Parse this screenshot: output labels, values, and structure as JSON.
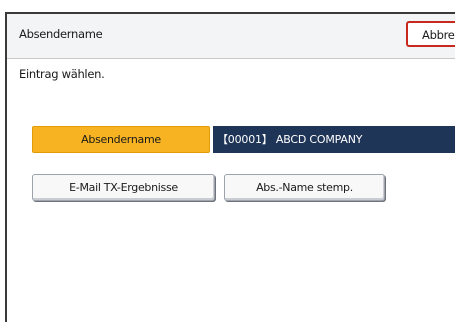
{
  "header": {
    "title": "Absendername",
    "abort_label": "Abbre"
  },
  "instruction": "Eintrag wählen.",
  "field": {
    "label": "Absendername",
    "value": "【00001】 ABCD COMPANY"
  },
  "buttons": {
    "tx_results": "E-Mail TX-Ergebnisse",
    "name_stamp": "Abs.-Name stemp."
  },
  "colors": {
    "accent_orange": "#f7b321",
    "value_background": "#1f3557",
    "abort_border": "#c8291e"
  }
}
